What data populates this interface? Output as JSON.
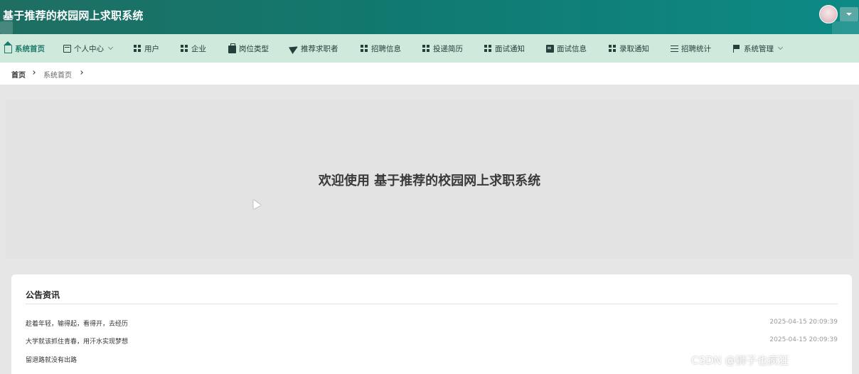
{
  "app": {
    "title": "基于推荐的校园网上求职系统"
  },
  "nav": {
    "items": [
      {
        "label": "系统首页",
        "icon": "home-icon",
        "active": true
      },
      {
        "label": "个人中心",
        "icon": "id-card-icon",
        "dropdown": true
      },
      {
        "label": "用户",
        "icon": "grid-icon"
      },
      {
        "label": "企业",
        "icon": "grid-icon"
      },
      {
        "label": "岗位类型",
        "icon": "briefcase-icon"
      },
      {
        "label": "推荐求职者",
        "icon": "send-icon"
      },
      {
        "label": "招聘信息",
        "icon": "grid-icon"
      },
      {
        "label": "投递简历",
        "icon": "grid-icon"
      },
      {
        "label": "面试通知",
        "icon": "grid-icon"
      },
      {
        "label": "面试信息",
        "icon": "document-icon"
      },
      {
        "label": "录取通知",
        "icon": "grid-icon"
      },
      {
        "label": "招聘统计",
        "icon": "sliders-icon"
      },
      {
        "label": "系统管理",
        "icon": "flag-icon",
        "dropdown": true
      }
    ]
  },
  "breadcrumb": {
    "home": "首页",
    "current": "系统首页"
  },
  "welcome": {
    "text": "欢迎使用 基于推荐的校园网上求职系统"
  },
  "notices": {
    "title": "公告资讯",
    "items": [
      {
        "title": "趁着年轻，输得起，看得开，去经历",
        "date": "2025-04-15 20:09:39"
      },
      {
        "title": "大学就该抓住青春，用汗水实现梦想",
        "date": "2025-04-15 20:09:39"
      },
      {
        "title": "留退路就没有出路",
        "date": ""
      }
    ]
  },
  "watermark": "CSDN @狮子也疯狂",
  "colors": {
    "header_start": "#1f6e62",
    "header_end": "#0d8a86",
    "nav_bg": "#cfe9dc",
    "accent": "#1c7a6b"
  }
}
